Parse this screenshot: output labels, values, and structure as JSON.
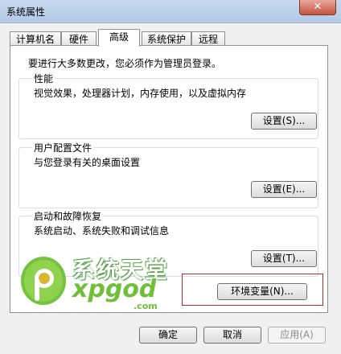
{
  "window": {
    "title": "系统属性",
    "close_glyph": "✕"
  },
  "tabs": [
    {
      "label": "计算机名",
      "active": false
    },
    {
      "label": "硬件",
      "active": false
    },
    {
      "label": "高级",
      "active": true
    },
    {
      "label": "系统保护",
      "active": false
    },
    {
      "label": "远程",
      "active": false
    }
  ],
  "advanced": {
    "admin_note": "要进行大多数更改，您必须作为管理员登录。",
    "performance": {
      "title": "性能",
      "description": "视觉效果，处理器计划，内存使用，以及虚拟内存",
      "button": "设置(S)..."
    },
    "user_profiles": {
      "title": "用户配置文件",
      "description": "与您登录有关的桌面设置",
      "button": "设置(E)..."
    },
    "startup_recovery": {
      "title": "启动和故障恢复",
      "description": "系统启动、系统失败和调试信息",
      "button": "设置(T)..."
    },
    "env_vars_button": "环境变量(N)..."
  },
  "footer": {
    "ok": "确定",
    "cancel": "取消",
    "apply": "应用(A)"
  },
  "watermark": {
    "cn_text": "系统天堂",
    "en_text": "xpgod",
    "domain": ".com",
    "icon": "xpgod-logo-icon",
    "accent_color": "#6fbf3a"
  }
}
